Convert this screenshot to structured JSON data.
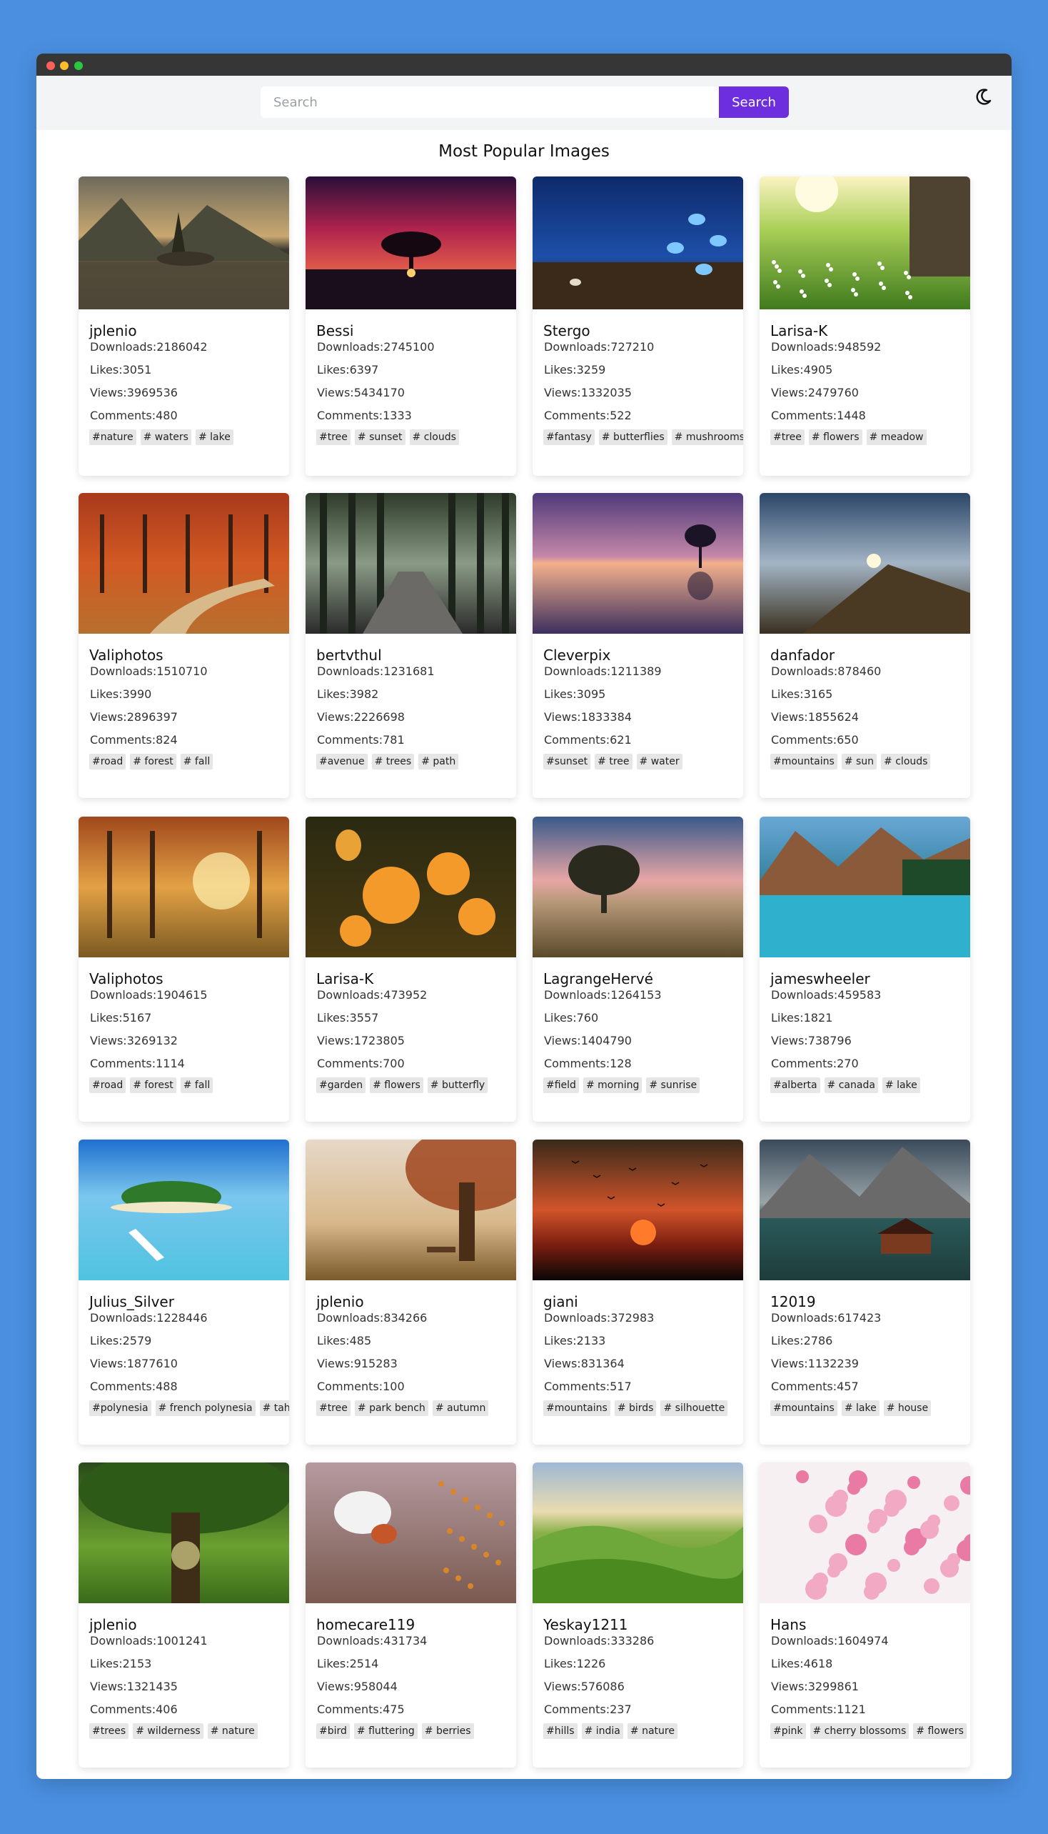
{
  "search": {
    "placeholder": "Search",
    "button_label": "Search"
  },
  "theme_toggle_icon": "moon-icon",
  "page_title": "Most Popular Images",
  "colors": {
    "accent": "#6d2ee0",
    "background": "#4a8fe0",
    "tag_bg": "#e6e6e6"
  },
  "cards": [
    {
      "user": "jplenio",
      "downloads": "Downloads:2186042",
      "likes": "Likes:3051",
      "views": "Views:3969536",
      "comments": "Comments:480",
      "tags": [
        "#nature",
        "# waters",
        "# lake"
      ],
      "image": "mountain lake with trees at sunset"
    },
    {
      "user": "Bessi",
      "downloads": "Downloads:2745100",
      "likes": "Likes:6397",
      "views": "Views:5434170",
      "comments": "Comments:1333",
      "tags": [
        "#tree",
        "# sunset",
        "# clouds"
      ],
      "image": "lone tree silhouette under red sky"
    },
    {
      "user": "Stergo",
      "downloads": "Downloads:727210",
      "likes": "Likes:3259",
      "views": "Views:1332035",
      "comments": "Comments:522",
      "tags": [
        "#fantasy",
        "# butterflies",
        "# mushrooms"
      ],
      "image": "blue butterflies and mushrooms"
    },
    {
      "user": "Larisa-K",
      "downloads": "Downloads:948592",
      "likes": "Likes:4905",
      "views": "Views:2479760",
      "comments": "Comments:1448",
      "tags": [
        "#tree",
        "# flowers",
        "# meadow"
      ],
      "image": "sunny meadow with flowers"
    },
    {
      "user": "Valiphotos",
      "downloads": "Downloads:1510710",
      "likes": "Likes:3990",
      "views": "Views:2896397",
      "comments": "Comments:824",
      "tags": [
        "#road",
        "# forest",
        "# fall"
      ],
      "image": "red autumn forest path"
    },
    {
      "user": "bertvthul",
      "downloads": "Downloads:1231681",
      "likes": "Likes:3982",
      "views": "Views:2226698",
      "comments": "Comments:781",
      "tags": [
        "#avenue",
        "# trees",
        "# path"
      ],
      "image": "misty forest avenue"
    },
    {
      "user": "Cleverpix",
      "downloads": "Downloads:1211389",
      "likes": "Likes:3095",
      "views": "Views:1833384",
      "comments": "Comments:621",
      "tags": [
        "#sunset",
        "# tree",
        "# water"
      ],
      "image": "tree in still water at dusk"
    },
    {
      "user": "danfador",
      "downloads": "Downloads:878460",
      "likes": "Likes:3165",
      "views": "Views:1855624",
      "comments": "Comments:650",
      "tags": [
        "#mountains",
        "# sun",
        "# clouds"
      ],
      "image": "mountain above clouds"
    },
    {
      "user": "Valiphotos",
      "downloads": "Downloads:1904615",
      "likes": "Likes:5167",
      "views": "Views:3269132",
      "comments": "Comments:1114",
      "tags": [
        "#road",
        "# forest",
        "# fall"
      ],
      "image": "autumn forest with sunlight"
    },
    {
      "user": "Larisa-K",
      "downloads": "Downloads:473952",
      "likes": "Likes:3557",
      "views": "Views:1723805",
      "comments": "Comments:700",
      "tags": [
        "#garden",
        "# flowers",
        "# butterfly"
      ],
      "image": "orange flowers with butterfly"
    },
    {
      "user": "LagrangeHervé",
      "downloads": "Downloads:1264153",
      "likes": "Likes:760",
      "views": "Views:1404790",
      "comments": "Comments:128",
      "tags": [
        "#field",
        "# morning",
        "# sunrise"
      ],
      "image": "tree in field at sunrise"
    },
    {
      "user": "jameswheeler",
      "downloads": "Downloads:459583",
      "likes": "Likes:1821",
      "views": "Views:738796",
      "comments": "Comments:270",
      "tags": [
        "#alberta",
        "# canada",
        "# lake"
      ],
      "image": "turquoise mountain lake"
    },
    {
      "user": "Julius_Silver",
      "downloads": "Downloads:1228446",
      "likes": "Likes:2579",
      "views": "Views:1877610",
      "comments": "Comments:488",
      "tags": [
        "#polynesia",
        "# french polynesia",
        "# tahiti"
      ],
      "image": "tropical island with boat"
    },
    {
      "user": "jplenio",
      "downloads": "Downloads:834266",
      "likes": "Likes:485",
      "views": "Views:915283",
      "comments": "Comments:100",
      "tags": [
        "#tree",
        "# park bench",
        "# autumn"
      ],
      "image": "autumn tree with park bench"
    },
    {
      "user": "giani",
      "downloads": "Downloads:372983",
      "likes": "Likes:2133",
      "views": "Views:831364",
      "comments": "Comments:517",
      "tags": [
        "#mountains",
        "# birds",
        "# silhouette"
      ],
      "image": "red sunset with birds"
    },
    {
      "user": "12019",
      "downloads": "Downloads:617423",
      "likes": "Likes:2786",
      "views": "Views:1132239",
      "comments": "Comments:457",
      "tags": [
        "#mountains",
        "# lake",
        "# house"
      ],
      "image": "alpine lake with boathouse"
    },
    {
      "user": "jplenio",
      "downloads": "Downloads:1001241",
      "likes": "Likes:2153",
      "views": "Views:1321435",
      "comments": "Comments:406",
      "tags": [
        "#trees",
        "# wilderness",
        "# nature"
      ],
      "image": "large green tree canopy"
    },
    {
      "user": "homecare119",
      "downloads": "Downloads:431734",
      "likes": "Likes:2514",
      "views": "Views:958044",
      "comments": "Comments:475",
      "tags": [
        "#bird",
        "# fluttering",
        "# berries"
      ],
      "image": "bird fluttering near berries"
    },
    {
      "user": "Yeskay1211",
      "downloads": "Downloads:333286",
      "likes": "Likes:1226",
      "views": "Views:576086",
      "comments": "Comments:237",
      "tags": [
        "#hills",
        "# india",
        "# nature"
      ],
      "image": "green rolling hills"
    },
    {
      "user": "Hans",
      "downloads": "Downloads:1604974",
      "likes": "Likes:4618",
      "views": "Views:3299861",
      "comments": "Comments:1121",
      "tags": [
        "#pink",
        "# cherry blossoms",
        "# flowers"
      ],
      "image": "pink cherry blossoms"
    }
  ]
}
